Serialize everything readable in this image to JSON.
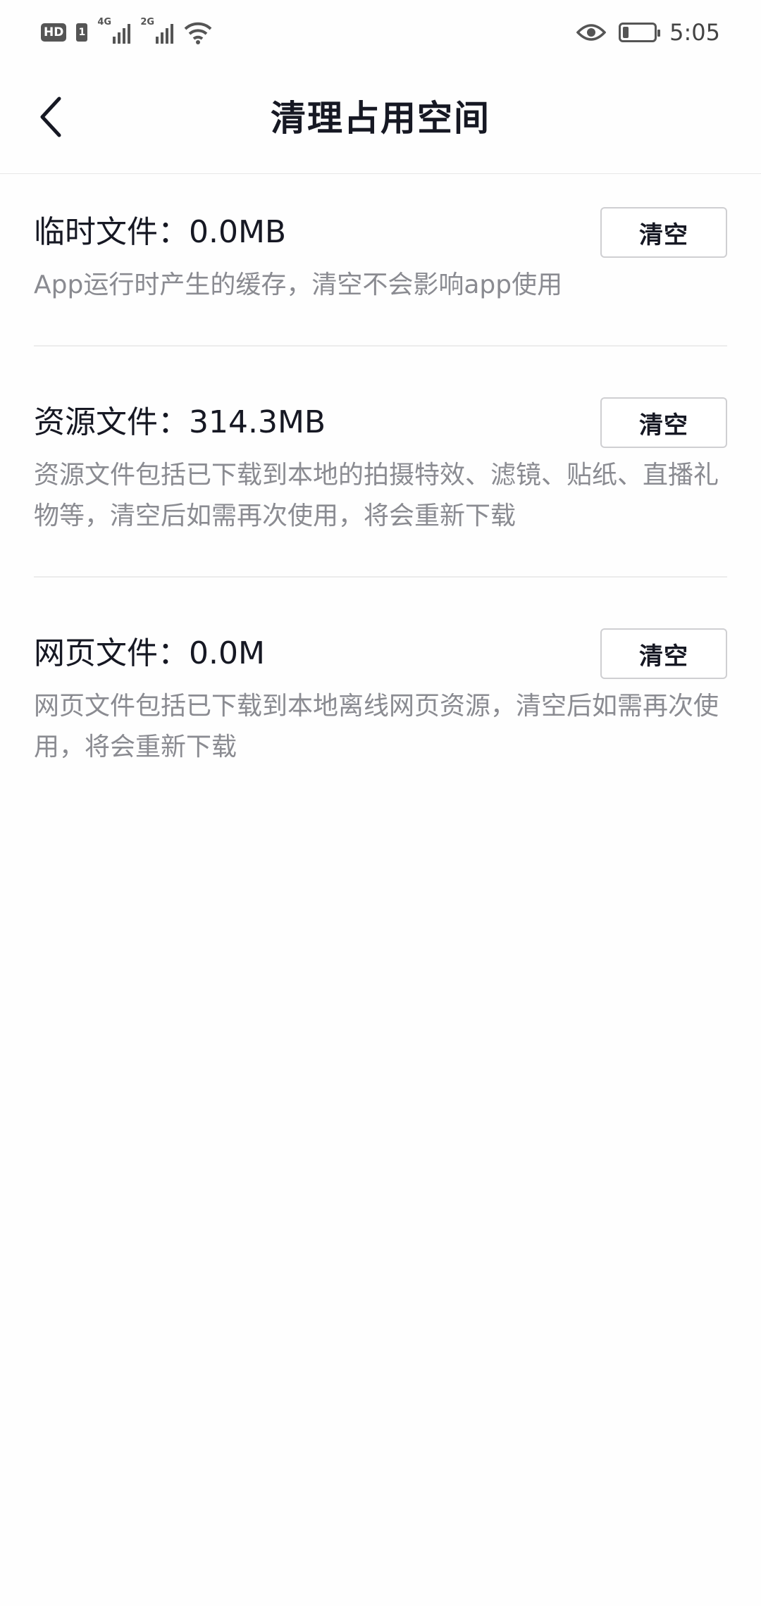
{
  "status_bar": {
    "hd_label": "HD",
    "sim_label": "1",
    "network1": "4G",
    "network2": "2G",
    "time": "5:05"
  },
  "header": {
    "title": "清理占用空间"
  },
  "sections": [
    {
      "title": "临时文件：0.0MB",
      "description": "App运行时产生的缓存，清空不会影响app使用",
      "button": "清空"
    },
    {
      "title": "资源文件：314.3MB",
      "description": "资源文件包括已下载到本地的拍摄特效、滤镜、贴纸、直播礼物等，清空后如需再次使用，将会重新下载",
      "button": "清空"
    },
    {
      "title": "网页文件：0.0M",
      "description": "网页文件包括已下载到本地离线网页资源，清空后如需再次使用，将会重新下载",
      "button": "清空"
    }
  ],
  "icons": {
    "back": "chevron-left-icon",
    "eye": "eye-icon",
    "wifi": "wifi-icon",
    "battery": "battery-icon",
    "signal": "signal-icon"
  },
  "battery_level": 0.2
}
